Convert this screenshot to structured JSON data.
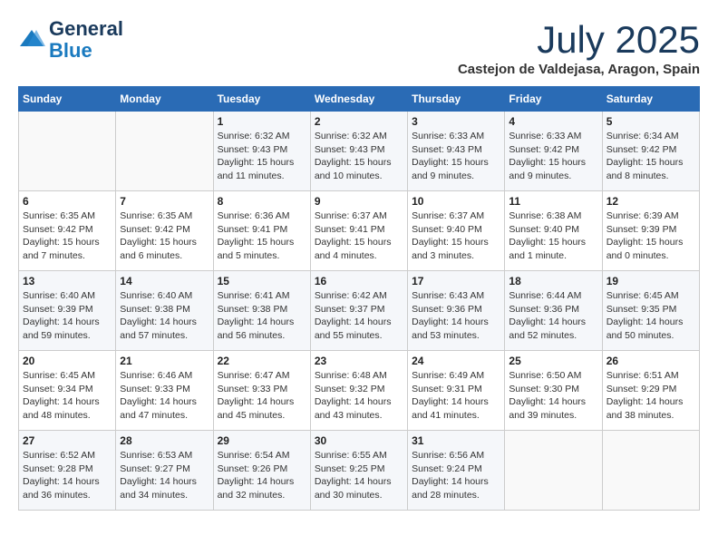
{
  "header": {
    "logo_general": "General",
    "logo_blue": "Blue",
    "month_title": "July 2025",
    "subtitle": "Castejon de Valdejasa, Aragon, Spain"
  },
  "weekdays": [
    "Sunday",
    "Monday",
    "Tuesday",
    "Wednesday",
    "Thursday",
    "Friday",
    "Saturday"
  ],
  "weeks": [
    [
      {
        "day": "",
        "info": ""
      },
      {
        "day": "",
        "info": ""
      },
      {
        "day": "1",
        "info": "Sunrise: 6:32 AM\nSunset: 9:43 PM\nDaylight: 15 hours and 11 minutes."
      },
      {
        "day": "2",
        "info": "Sunrise: 6:32 AM\nSunset: 9:43 PM\nDaylight: 15 hours and 10 minutes."
      },
      {
        "day": "3",
        "info": "Sunrise: 6:33 AM\nSunset: 9:43 PM\nDaylight: 15 hours and 9 minutes."
      },
      {
        "day": "4",
        "info": "Sunrise: 6:33 AM\nSunset: 9:42 PM\nDaylight: 15 hours and 9 minutes."
      },
      {
        "day": "5",
        "info": "Sunrise: 6:34 AM\nSunset: 9:42 PM\nDaylight: 15 hours and 8 minutes."
      }
    ],
    [
      {
        "day": "6",
        "info": "Sunrise: 6:35 AM\nSunset: 9:42 PM\nDaylight: 15 hours and 7 minutes."
      },
      {
        "day": "7",
        "info": "Sunrise: 6:35 AM\nSunset: 9:42 PM\nDaylight: 15 hours and 6 minutes."
      },
      {
        "day": "8",
        "info": "Sunrise: 6:36 AM\nSunset: 9:41 PM\nDaylight: 15 hours and 5 minutes."
      },
      {
        "day": "9",
        "info": "Sunrise: 6:37 AM\nSunset: 9:41 PM\nDaylight: 15 hours and 4 minutes."
      },
      {
        "day": "10",
        "info": "Sunrise: 6:37 AM\nSunset: 9:40 PM\nDaylight: 15 hours and 3 minutes."
      },
      {
        "day": "11",
        "info": "Sunrise: 6:38 AM\nSunset: 9:40 PM\nDaylight: 15 hours and 1 minute."
      },
      {
        "day": "12",
        "info": "Sunrise: 6:39 AM\nSunset: 9:39 PM\nDaylight: 15 hours and 0 minutes."
      }
    ],
    [
      {
        "day": "13",
        "info": "Sunrise: 6:40 AM\nSunset: 9:39 PM\nDaylight: 14 hours and 59 minutes."
      },
      {
        "day": "14",
        "info": "Sunrise: 6:40 AM\nSunset: 9:38 PM\nDaylight: 14 hours and 57 minutes."
      },
      {
        "day": "15",
        "info": "Sunrise: 6:41 AM\nSunset: 9:38 PM\nDaylight: 14 hours and 56 minutes."
      },
      {
        "day": "16",
        "info": "Sunrise: 6:42 AM\nSunset: 9:37 PM\nDaylight: 14 hours and 55 minutes."
      },
      {
        "day": "17",
        "info": "Sunrise: 6:43 AM\nSunset: 9:36 PM\nDaylight: 14 hours and 53 minutes."
      },
      {
        "day": "18",
        "info": "Sunrise: 6:44 AM\nSunset: 9:36 PM\nDaylight: 14 hours and 52 minutes."
      },
      {
        "day": "19",
        "info": "Sunrise: 6:45 AM\nSunset: 9:35 PM\nDaylight: 14 hours and 50 minutes."
      }
    ],
    [
      {
        "day": "20",
        "info": "Sunrise: 6:45 AM\nSunset: 9:34 PM\nDaylight: 14 hours and 48 minutes."
      },
      {
        "day": "21",
        "info": "Sunrise: 6:46 AM\nSunset: 9:33 PM\nDaylight: 14 hours and 47 minutes."
      },
      {
        "day": "22",
        "info": "Sunrise: 6:47 AM\nSunset: 9:33 PM\nDaylight: 14 hours and 45 minutes."
      },
      {
        "day": "23",
        "info": "Sunrise: 6:48 AM\nSunset: 9:32 PM\nDaylight: 14 hours and 43 minutes."
      },
      {
        "day": "24",
        "info": "Sunrise: 6:49 AM\nSunset: 9:31 PM\nDaylight: 14 hours and 41 minutes."
      },
      {
        "day": "25",
        "info": "Sunrise: 6:50 AM\nSunset: 9:30 PM\nDaylight: 14 hours and 39 minutes."
      },
      {
        "day": "26",
        "info": "Sunrise: 6:51 AM\nSunset: 9:29 PM\nDaylight: 14 hours and 38 minutes."
      }
    ],
    [
      {
        "day": "27",
        "info": "Sunrise: 6:52 AM\nSunset: 9:28 PM\nDaylight: 14 hours and 36 minutes."
      },
      {
        "day": "28",
        "info": "Sunrise: 6:53 AM\nSunset: 9:27 PM\nDaylight: 14 hours and 34 minutes."
      },
      {
        "day": "29",
        "info": "Sunrise: 6:54 AM\nSunset: 9:26 PM\nDaylight: 14 hours and 32 minutes."
      },
      {
        "day": "30",
        "info": "Sunrise: 6:55 AM\nSunset: 9:25 PM\nDaylight: 14 hours and 30 minutes."
      },
      {
        "day": "31",
        "info": "Sunrise: 6:56 AM\nSunset: 9:24 PM\nDaylight: 14 hours and 28 minutes."
      },
      {
        "day": "",
        "info": ""
      },
      {
        "day": "",
        "info": ""
      }
    ]
  ]
}
